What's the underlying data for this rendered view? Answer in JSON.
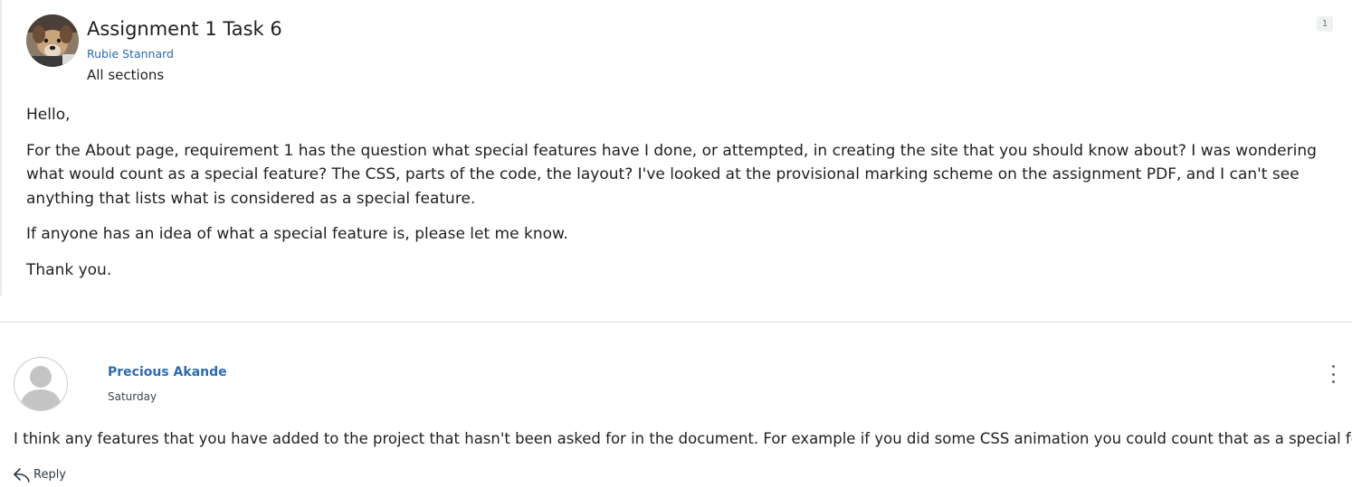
{
  "topic": {
    "title": "Assignment 1 Task 6",
    "author": "Rubie Stannard",
    "sections": "All sections",
    "count_badge": "1",
    "avatar_icon": "user-photo-avatar",
    "body": [
      "Hello,",
      "For the About page, requirement 1 has the question what special features have I done, or attempted, in creating the site that you should know about? I was wondering what would count as a special feature? The CSS, parts of the code, the layout? I've looked at the provisional marking scheme on the assignment PDF, and I can't see anything that lists what is considered as a special feature.",
      "If anyone has an idea of what a special feature is, please let me know.",
      "Thank you."
    ]
  },
  "reply": {
    "author": "Precious Akande",
    "date": "Saturday",
    "body": "I think any features that you have added to the project that hasn't been asked for in the document. For example if you did some CSS animation you could count that as a special feature.",
    "reply_label": "Reply",
    "avatar_icon": "default-user-avatar",
    "menu_icon": "kebab-menu-icon",
    "reply_icon": "reply-arrow-icon"
  },
  "colors": {
    "link": "#2b6ab0",
    "text": "#1f1f1f",
    "divider": "#d7dadd"
  }
}
